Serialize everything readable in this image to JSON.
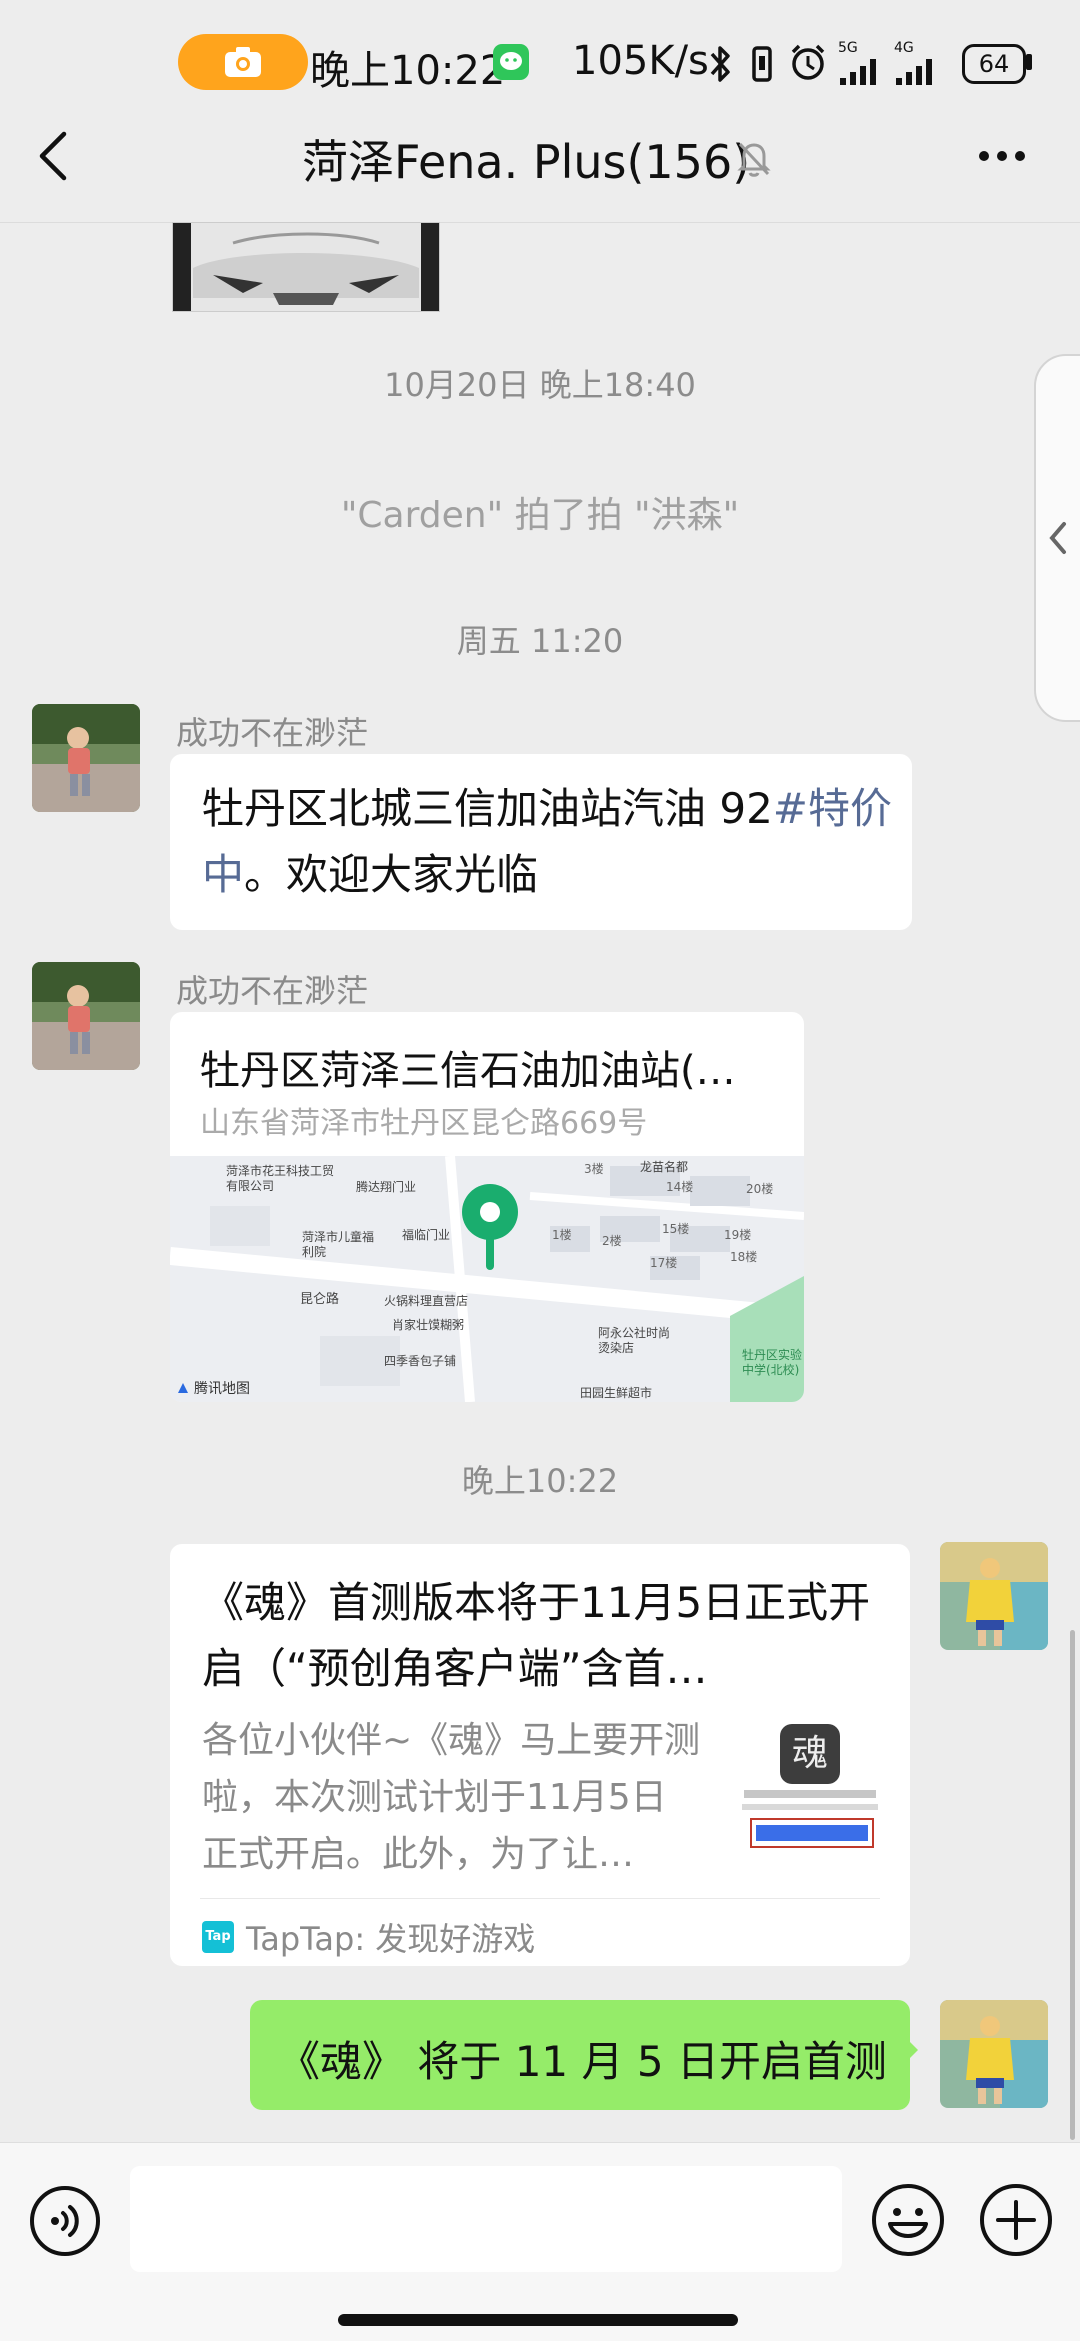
{
  "status_bar": {
    "time": "晚上10:22",
    "net_speed": "105K/s",
    "network_5g": "5G",
    "network_4g": "4G",
    "battery": "64"
  },
  "header": {
    "title": "菏泽Fena. Plus(156)"
  },
  "messages": {
    "timestamp1": "10月20日 晚上18:40",
    "system_pat": "\"Carden\" 拍了拍 \"洪森\"",
    "timestamp2": "周五 11:20",
    "msg1": {
      "sender": "成功不在渺茫",
      "text_prefix": "牡丹区北城三信加油站汽油 92",
      "text_hashtag": "#特价中",
      "text_suffix": "。欢迎大家光临"
    },
    "msg2": {
      "sender": "成功不在渺茫",
      "location_title": "牡丹区菏泽三信石油加油站(…",
      "location_address": "山东省菏泽市牡丹区昆仑路669号",
      "map_brand": "腾讯地图",
      "map_labels": [
        "菏泽市花王科技工贸有限公司",
        "腾达翔门业",
        "福临门业",
        "菏泽市儿童福利院",
        "昆仑路",
        "火锅料理直营店",
        "肖家壮馍糊粥",
        "阿永公社时尚烫染店",
        "四季香包子铺",
        "田园生鲜超市",
        "牡丹区实验中学(北校)",
        "龙苗名都",
        "14楼",
        "15楼",
        "17楼",
        "18楼",
        "19楼",
        "20楼",
        "1楼",
        "2楼",
        "3楼"
      ]
    },
    "timestamp3": "晚上10:22",
    "msg3": {
      "title": "《魂》首测版本将于11月5日正式开启（“预创角客户端”含首…",
      "desc": "各位小伙伴~《魂》马上要开测啦，本次测试计划于11月5日正式开启。此外，为了让…",
      "source": "TapTap: 发现好游戏",
      "source_logo": "Tap",
      "thumb_char": "魂"
    },
    "msg4": {
      "text": "《魂》 将于 11 月 5 日开启首测"
    }
  },
  "colors": {
    "accent_green": "#95ec69",
    "hashtag": "#576b95",
    "background": "#ededed",
    "map_pin": "#1aad6e"
  },
  "icons": [
    "camera-icon",
    "wechat-icon",
    "bluetooth-icon",
    "vibrate-icon",
    "alarm-icon",
    "signal-icon",
    "battery-icon",
    "back-icon",
    "mute-bell-icon",
    "more-icon",
    "voice-icon",
    "emoji-icon",
    "add-icon"
  ]
}
